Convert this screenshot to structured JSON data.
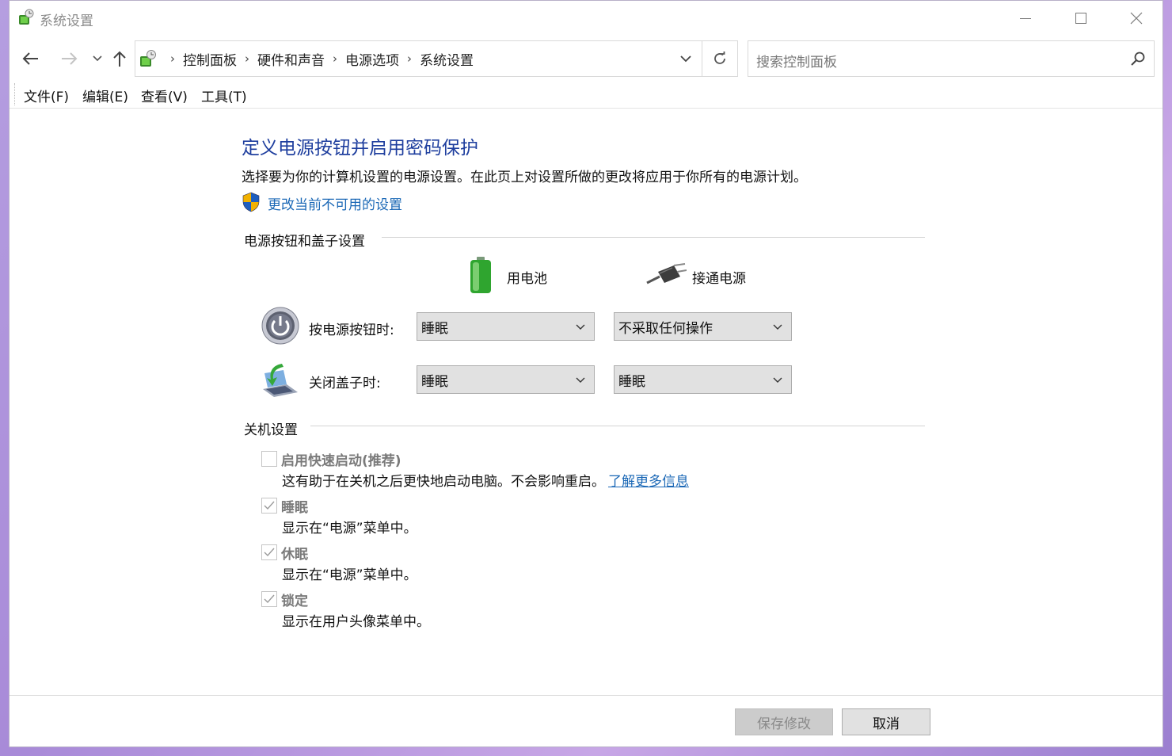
{
  "window": {
    "title": "系统设置",
    "controls": {
      "minimize": "minimize-icon",
      "maximize": "maximize-icon",
      "close": "close-icon"
    }
  },
  "nav": {
    "breadcrumbs": [
      "控制面板",
      "硬件和声音",
      "电源选项",
      "系统设置"
    ],
    "search_placeholder": "搜索控制面板"
  },
  "menu": [
    "文件(F)",
    "编辑(E)",
    "查看(V)",
    "工具(T)"
  ],
  "page": {
    "title": "定义电源按钮并启用密码保护",
    "description": "选择要为你的计算机设置的电源设置。在此页上对设置所做的更改将应用于你所有的电源计划。",
    "change_link": "更改当前不可用的设置"
  },
  "power_section": {
    "label": "电源按钮和盖子设置",
    "col_battery": "用电池",
    "col_plugged": "接通电源",
    "rows": [
      {
        "label": "按电源按钮时:",
        "battery": "睡眠",
        "plugged": "不采取任何操作"
      },
      {
        "label": "关闭盖子时:",
        "battery": "睡眠",
        "plugged": "睡眠"
      }
    ]
  },
  "shutdown_section": {
    "label": "关机设置",
    "options": [
      {
        "title": "启用快速启动(推荐)",
        "desc": "这有助于在关机之后更快地启动电脑。不会影响重启。",
        "link": "了解更多信息",
        "checked": false
      },
      {
        "title": "睡眠",
        "desc": "显示在“电源”菜单中。",
        "checked": true
      },
      {
        "title": "休眠",
        "desc": "显示在“电源”菜单中。",
        "checked": true
      },
      {
        "title": "锁定",
        "desc": "显示在用户头像菜单中。",
        "checked": true
      }
    ]
  },
  "buttons": {
    "save": "保存修改",
    "cancel": "取消"
  },
  "colors": {
    "title_blue": "#1e3e9e",
    "link_blue": "#1b68b6"
  }
}
